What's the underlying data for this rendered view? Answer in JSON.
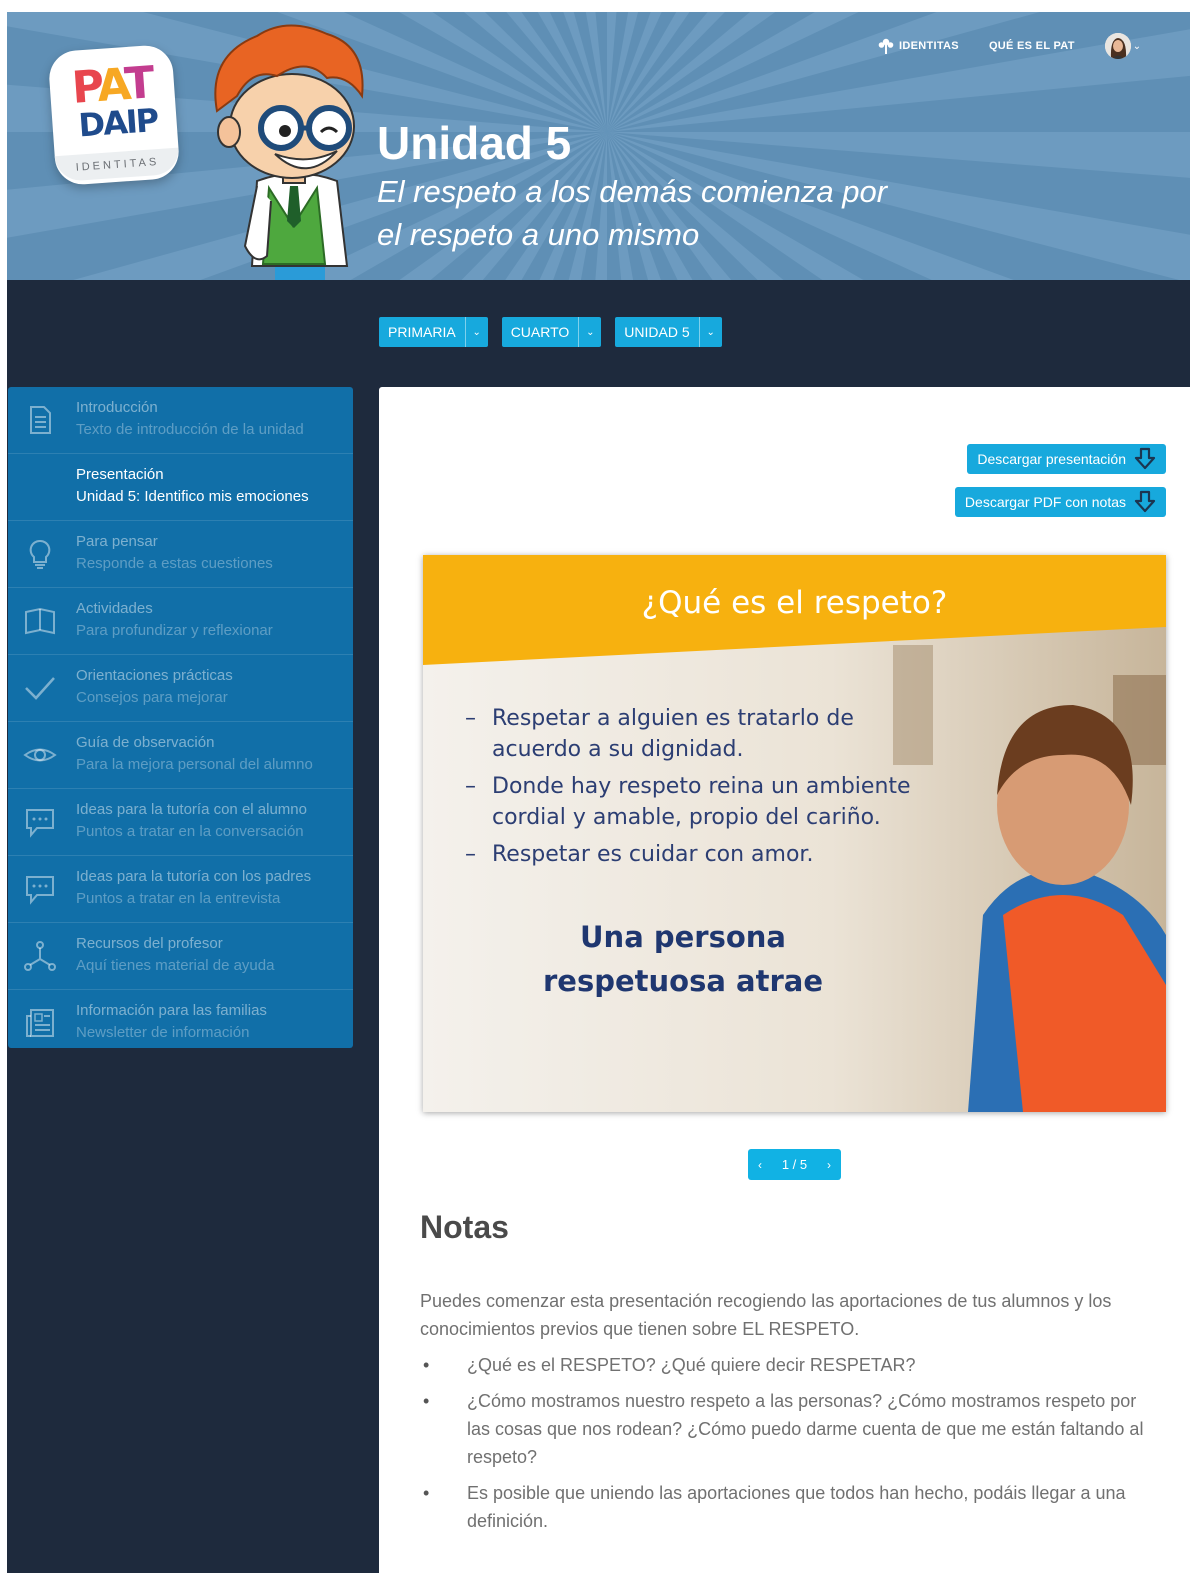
{
  "header": {
    "logo": {
      "pat": "PAT",
      "daip": "DAIP",
      "tagline": "IDENTITAS"
    },
    "unit_title": "Unidad 5",
    "unit_subtitle": "El respeto a los demás comienza por el respeto a uno mismo",
    "nav": [
      {
        "label": "IDENTITAS",
        "icon": "tree-icon"
      },
      {
        "label": "QUÉ ES EL PAT"
      }
    ],
    "user_menu": {
      "icon": "chevron-down-icon"
    }
  },
  "selectors": [
    {
      "value": "PRIMARIA"
    },
    {
      "value": "CUARTO"
    },
    {
      "value": "UNIDAD 5"
    }
  ],
  "sidebar": {
    "items": [
      {
        "title": "Introducción",
        "subtitle": "Texto de introducción de la unidad",
        "icon": "document-icon"
      },
      {
        "title": "Presentación",
        "subtitle": "Unidad 5: Identifico mis emociones",
        "icon": "",
        "active": true
      },
      {
        "title": "Para pensar",
        "subtitle": "Responde a estas cuestiones",
        "icon": "lightbulb-icon"
      },
      {
        "title": "Actividades",
        "subtitle": "Para profundizar y reflexionar",
        "icon": "book-icon"
      },
      {
        "title": "Orientaciones prácticas",
        "subtitle": "Consejos para mejorar",
        "icon": "checkmark-icon"
      },
      {
        "title": "Guía de observación",
        "subtitle": "Para la mejora personal del alumno",
        "icon": "eye-icon"
      },
      {
        "title": "Ideas para la tutoría con el alumno",
        "subtitle": "Puntos a tratar en la conversación",
        "icon": "chat-icon"
      },
      {
        "title": "Ideas para la tutoría con los padres",
        "subtitle": "Puntos a tratar en la entrevista",
        "icon": "chat-icon"
      },
      {
        "title": "Recursos del profesor",
        "subtitle": "Aquí tienes material de ayuda",
        "icon": "share-nodes-icon"
      },
      {
        "title": "Información para las familias",
        "subtitle": "Newsletter de información",
        "icon": "newspaper-icon"
      }
    ]
  },
  "main": {
    "download_presentation": "Descargar presentación",
    "download_pdf": "Descargar PDF con notas",
    "slide": {
      "heading": "¿Qué es el respeto?",
      "bullets": [
        "Respetar a alguien es tratarlo de acuerdo a su dignidad.",
        "Donde hay respeto reina un ambiente cordial y amable, propio del cariño.",
        "Respetar es cuidar con amor."
      ],
      "highlight": "Una persona respetuosa atrae"
    },
    "pager": {
      "text": "1 / 5",
      "current": 1,
      "total": 5
    },
    "notes": {
      "title": "Notas",
      "intro": "Puedes comenzar esta presentación recogiendo las aportaciones de tus alumnos y los conocimientos previos que tienen sobre EL RESPETO.",
      "items": [
        "¿Qué es el RESPETO? ¿Qué quiere decir RESPETAR?",
        "¿Cómo mostramos nuestro respeto a las personas? ¿Cómo mostramos respeto por las cosas que nos rodean? ¿Cómo puedo darme cuenta de que me están faltando al respeto?",
        "Es posible que uniendo las aportaciones que todos han hecho, podáis llegar a una definición."
      ]
    }
  },
  "colors": {
    "hero_bg": "#5f8fb5",
    "page_bg": "#1e2a3d",
    "sidebar_bg": "#116fa8",
    "accent": "#17a9dd",
    "slide_band": "#f7b10f"
  }
}
